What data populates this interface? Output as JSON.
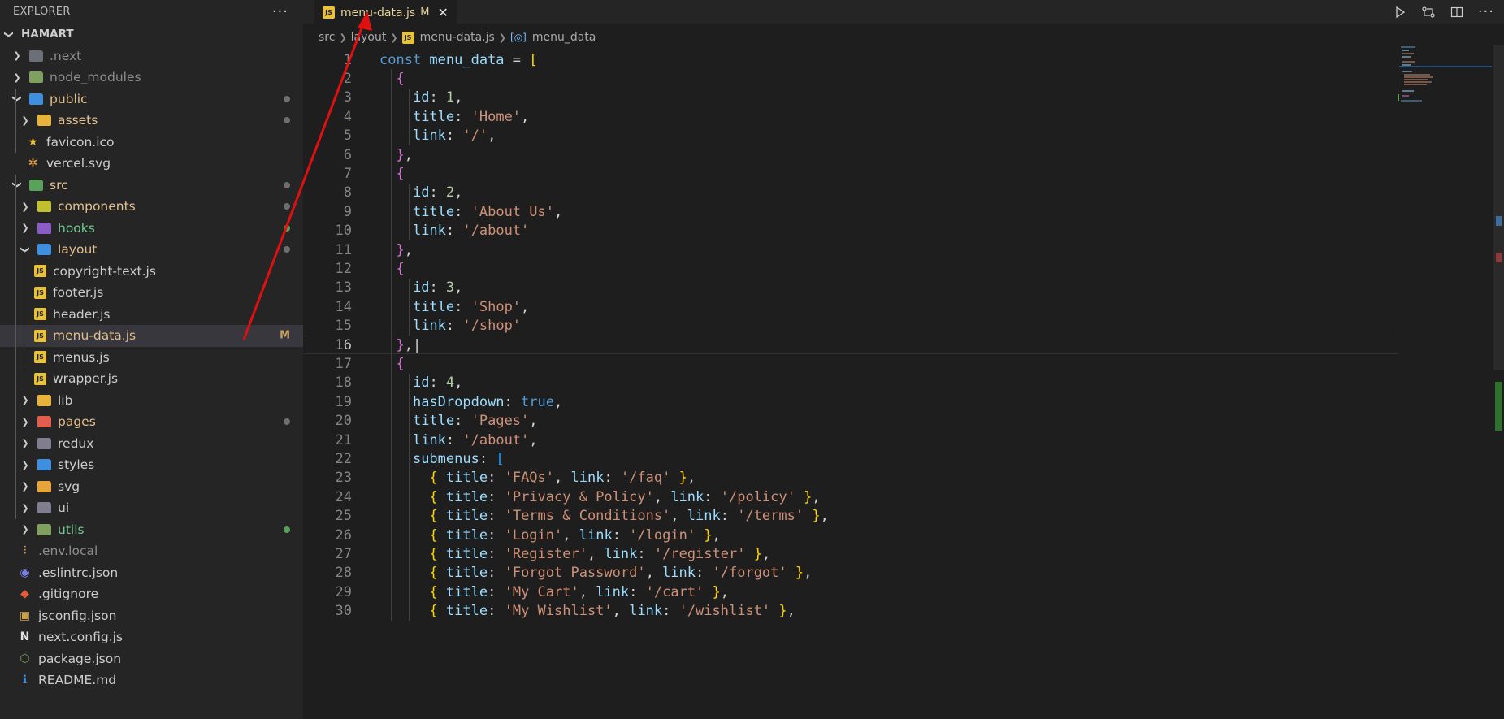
{
  "sidebar": {
    "title": "EXPLORER",
    "more": "···",
    "root": "HAMART",
    "items": [
      {
        "label": ".next",
        "depth": 1,
        "kind": "folder",
        "open": false,
        "icon": "next-folder-icon",
        "iconColor": "#6b6f77",
        "iconText": "N",
        "textColor": "#8c8c8c",
        "badge": ""
      },
      {
        "label": "node_modules",
        "depth": 1,
        "kind": "folder",
        "open": false,
        "icon": "node-folder-icon",
        "iconColor": "#7fa05e",
        "iconText": "",
        "textColor": "#8c8c8c",
        "badge": ""
      },
      {
        "label": "public",
        "depth": 1,
        "kind": "folder",
        "open": true,
        "icon": "public-folder-icon",
        "iconColor": "#3e8fe0",
        "iconText": "",
        "textColor": "#e2c08d",
        "badge": "dot"
      },
      {
        "label": "assets",
        "depth": 2,
        "kind": "folder",
        "open": false,
        "icon": "assets-folder-icon",
        "iconColor": "#e8b33a",
        "iconText": "",
        "textColor": "#e2c08d",
        "badge": "dot"
      },
      {
        "label": "favicon.ico",
        "depth": 2,
        "kind": "file",
        "icon": "star-icon",
        "glyph": "★",
        "glyphColor": "#e8c33a",
        "textColor": "#cccccc",
        "badge": ""
      },
      {
        "label": "vercel.svg",
        "depth": 2,
        "kind": "file",
        "icon": "svg-file-icon",
        "glyph": "✲",
        "glyphColor": "#f0a030",
        "textColor": "#cccccc",
        "badge": ""
      },
      {
        "label": "src",
        "depth": 1,
        "kind": "folder",
        "open": true,
        "icon": "src-folder-icon",
        "iconColor": "#5aa15a",
        "iconText": "",
        "textColor": "#e2c08d",
        "badge": "dot"
      },
      {
        "label": "components",
        "depth": 2,
        "kind": "folder",
        "open": false,
        "icon": "components-folder-icon",
        "iconColor": "#c0c030",
        "iconText": "",
        "textColor": "#e2c08d",
        "badge": "dot"
      },
      {
        "label": "hooks",
        "depth": 2,
        "kind": "folder",
        "open": false,
        "icon": "hooks-folder-icon",
        "iconColor": "#8b5cc6",
        "iconText": "",
        "textColor": "#73c991",
        "badge": "green"
      },
      {
        "label": "layout",
        "depth": 2,
        "kind": "folder",
        "open": true,
        "icon": "layout-folder-icon",
        "iconColor": "#3e8fe0",
        "iconText": "",
        "textColor": "#e2c08d",
        "badge": "dot"
      },
      {
        "label": "copyright-text.js",
        "depth": 3,
        "kind": "js",
        "textColor": "#cccccc",
        "badge": ""
      },
      {
        "label": "footer.js",
        "depth": 3,
        "kind": "js",
        "textColor": "#cccccc",
        "badge": ""
      },
      {
        "label": "header.js",
        "depth": 3,
        "kind": "js",
        "textColor": "#cccccc",
        "badge": ""
      },
      {
        "label": "menu-data.js",
        "depth": 3,
        "kind": "js",
        "textColor": "#e2c08d",
        "badge": "M",
        "active": true
      },
      {
        "label": "menus.js",
        "depth": 3,
        "kind": "js",
        "textColor": "#cccccc",
        "badge": ""
      },
      {
        "label": "wrapper.js",
        "depth": 3,
        "kind": "js",
        "textColor": "#cccccc",
        "badge": ""
      },
      {
        "label": "lib",
        "depth": 2,
        "kind": "folder",
        "open": false,
        "icon": "lib-folder-icon",
        "iconColor": "#e8b33a",
        "iconText": "",
        "textColor": "#cccccc",
        "badge": ""
      },
      {
        "label": "pages",
        "depth": 2,
        "kind": "folder",
        "open": false,
        "icon": "pages-folder-icon",
        "iconColor": "#e35d4e",
        "iconText": "",
        "textColor": "#e2c08d",
        "badge": "dot"
      },
      {
        "label": "redux",
        "depth": 2,
        "kind": "folder",
        "open": false,
        "icon": "redux-folder-icon",
        "iconColor": "#7e7e8e",
        "iconText": "",
        "textColor": "#cccccc",
        "badge": ""
      },
      {
        "label": "styles",
        "depth": 2,
        "kind": "folder",
        "open": false,
        "icon": "styles-folder-icon",
        "iconColor": "#3e8fe0",
        "iconText": "",
        "textColor": "#cccccc",
        "badge": ""
      },
      {
        "label": "svg",
        "depth": 2,
        "kind": "folder",
        "open": false,
        "icon": "svg-folder-icon",
        "iconColor": "#e8a33a",
        "iconText": "",
        "textColor": "#cccccc",
        "badge": ""
      },
      {
        "label": "ui",
        "depth": 2,
        "kind": "folder",
        "open": false,
        "icon": "ui-folder-icon",
        "iconColor": "#7e7e8e",
        "iconText": "",
        "textColor": "#cccccc",
        "badge": ""
      },
      {
        "label": "utils",
        "depth": 2,
        "kind": "folder",
        "open": false,
        "icon": "utils-folder-icon",
        "iconColor": "#7fa05e",
        "iconText": "",
        "textColor": "#73c991",
        "badge": "green"
      },
      {
        "label": ".env.local",
        "depth": 1,
        "kind": "file",
        "icon": "env-file-icon",
        "glyph": "⫶",
        "glyphColor": "#e0a050",
        "textColor": "#8c8c8c",
        "badge": ""
      },
      {
        "label": ".eslintrc.json",
        "depth": 1,
        "kind": "file",
        "icon": "eslint-file-icon",
        "glyph": "◉",
        "glyphColor": "#7b7fe8",
        "textColor": "#cccccc",
        "badge": ""
      },
      {
        "label": ".gitignore",
        "depth": 1,
        "kind": "file",
        "icon": "git-file-icon",
        "glyph": "◆",
        "glyphColor": "#e55b3a",
        "textColor": "#cccccc",
        "badge": ""
      },
      {
        "label": "jsconfig.json",
        "depth": 1,
        "kind": "file",
        "icon": "jsconfig-file-icon",
        "glyph": "▣",
        "glyphColor": "#cfa23a",
        "textColor": "#cccccc",
        "badge": ""
      },
      {
        "label": "next.config.js",
        "depth": 1,
        "kind": "file",
        "icon": "next-file-icon",
        "glyph": "N",
        "glyphColor": "#e0e0e0",
        "textColor": "#cccccc",
        "badge": ""
      },
      {
        "label": "package.json",
        "depth": 1,
        "kind": "file",
        "icon": "package-file-icon",
        "glyph": "⬡",
        "glyphColor": "#7fa05e",
        "textColor": "#cccccc",
        "badge": ""
      },
      {
        "label": "README.md",
        "depth": 1,
        "kind": "file",
        "icon": "info-icon",
        "glyph": "ℹ",
        "glyphColor": "#3e8fe0",
        "textColor": "#cccccc",
        "badge": ""
      }
    ]
  },
  "tab": {
    "label": "menu-data.js",
    "modified": "M",
    "icon_text": "JS",
    "close": "✕"
  },
  "breadcrumb": {
    "parts": [
      "src",
      "layout",
      "menu-data.js"
    ],
    "symbol": "menu_data"
  },
  "editor": {
    "current_line": 16,
    "lines": [
      [
        [
          "key",
          "const "
        ],
        [
          "var",
          "menu_data"
        ],
        [
          "pun",
          " = "
        ],
        [
          "b1",
          "["
        ]
      ],
      [
        [
          "pun",
          "  "
        ],
        [
          "b2",
          "{"
        ]
      ],
      [
        [
          "pun",
          "    "
        ],
        [
          "var",
          "id"
        ],
        [
          "pun",
          ": "
        ],
        [
          "num",
          "1"
        ],
        [
          "pun",
          ","
        ]
      ],
      [
        [
          "pun",
          "    "
        ],
        [
          "var",
          "title"
        ],
        [
          "pun",
          ": "
        ],
        [
          "str",
          "'Home'"
        ],
        [
          "pun",
          ","
        ]
      ],
      [
        [
          "pun",
          "    "
        ],
        [
          "var",
          "link"
        ],
        [
          "pun",
          ": "
        ],
        [
          "str",
          "'/'"
        ],
        [
          "pun",
          ","
        ]
      ],
      [
        [
          "pun",
          "  "
        ],
        [
          "b2",
          "}"
        ],
        [
          "pun",
          ","
        ]
      ],
      [
        [
          "pun",
          "  "
        ],
        [
          "b2",
          "{"
        ]
      ],
      [
        [
          "pun",
          "    "
        ],
        [
          "var",
          "id"
        ],
        [
          "pun",
          ": "
        ],
        [
          "num",
          "2"
        ],
        [
          "pun",
          ","
        ]
      ],
      [
        [
          "pun",
          "    "
        ],
        [
          "var",
          "title"
        ],
        [
          "pun",
          ": "
        ],
        [
          "str",
          "'About Us'"
        ],
        [
          "pun",
          ","
        ]
      ],
      [
        [
          "pun",
          "    "
        ],
        [
          "var",
          "link"
        ],
        [
          "pun",
          ": "
        ],
        [
          "str",
          "'/about'"
        ]
      ],
      [
        [
          "pun",
          "  "
        ],
        [
          "b2",
          "}"
        ],
        [
          "pun",
          ","
        ]
      ],
      [
        [
          "pun",
          "  "
        ],
        [
          "b2",
          "{"
        ]
      ],
      [
        [
          "pun",
          "    "
        ],
        [
          "var",
          "id"
        ],
        [
          "pun",
          ": "
        ],
        [
          "num",
          "3"
        ],
        [
          "pun",
          ","
        ]
      ],
      [
        [
          "pun",
          "    "
        ],
        [
          "var",
          "title"
        ],
        [
          "pun",
          ": "
        ],
        [
          "str",
          "'Shop'"
        ],
        [
          "pun",
          ","
        ]
      ],
      [
        [
          "pun",
          "    "
        ],
        [
          "var",
          "link"
        ],
        [
          "pun",
          ": "
        ],
        [
          "str",
          "'/shop'"
        ]
      ],
      [
        [
          "pun",
          "  "
        ],
        [
          "b2",
          "}"
        ],
        [
          "pun",
          ",|"
        ]
      ],
      [
        [
          "pun",
          "  "
        ],
        [
          "b2",
          "{"
        ]
      ],
      [
        [
          "pun",
          "    "
        ],
        [
          "var",
          "id"
        ],
        [
          "pun",
          ": "
        ],
        [
          "num",
          "4"
        ],
        [
          "pun",
          ","
        ]
      ],
      [
        [
          "pun",
          "    "
        ],
        [
          "var",
          "hasDropdown"
        ],
        [
          "pun",
          ": "
        ],
        [
          "bool",
          "true"
        ],
        [
          "pun",
          ","
        ]
      ],
      [
        [
          "pun",
          "    "
        ],
        [
          "var",
          "title"
        ],
        [
          "pun",
          ": "
        ],
        [
          "str",
          "'Pages'"
        ],
        [
          "pun",
          ","
        ]
      ],
      [
        [
          "pun",
          "    "
        ],
        [
          "var",
          "link"
        ],
        [
          "pun",
          ": "
        ],
        [
          "str",
          "'/about'"
        ],
        [
          "pun",
          ","
        ]
      ],
      [
        [
          "pun",
          "    "
        ],
        [
          "var",
          "submenus"
        ],
        [
          "pun",
          ": "
        ],
        [
          "b3",
          "["
        ]
      ],
      [
        [
          "pun",
          "      "
        ],
        [
          "b1",
          "{"
        ],
        [
          "pun",
          " "
        ],
        [
          "var",
          "title"
        ],
        [
          "pun",
          ": "
        ],
        [
          "str",
          "'FAQs'"
        ],
        [
          "pun",
          ", "
        ],
        [
          "var",
          "link"
        ],
        [
          "pun",
          ": "
        ],
        [
          "str",
          "'/faq'"
        ],
        [
          "pun",
          " "
        ],
        [
          "b1",
          "}"
        ],
        [
          "pun",
          ","
        ]
      ],
      [
        [
          "pun",
          "      "
        ],
        [
          "b1",
          "{"
        ],
        [
          "pun",
          " "
        ],
        [
          "var",
          "title"
        ],
        [
          "pun",
          ": "
        ],
        [
          "str",
          "'Privacy & Policy'"
        ],
        [
          "pun",
          ", "
        ],
        [
          "var",
          "link"
        ],
        [
          "pun",
          ": "
        ],
        [
          "str",
          "'/policy'"
        ],
        [
          "pun",
          " "
        ],
        [
          "b1",
          "}"
        ],
        [
          "pun",
          ","
        ]
      ],
      [
        [
          "pun",
          "      "
        ],
        [
          "b1",
          "{"
        ],
        [
          "pun",
          " "
        ],
        [
          "var",
          "title"
        ],
        [
          "pun",
          ": "
        ],
        [
          "str",
          "'Terms & Conditions'"
        ],
        [
          "pun",
          ", "
        ],
        [
          "var",
          "link"
        ],
        [
          "pun",
          ": "
        ],
        [
          "str",
          "'/terms'"
        ],
        [
          "pun",
          " "
        ],
        [
          "b1",
          "}"
        ],
        [
          "pun",
          ","
        ]
      ],
      [
        [
          "pun",
          "      "
        ],
        [
          "b1",
          "{"
        ],
        [
          "pun",
          " "
        ],
        [
          "var",
          "title"
        ],
        [
          "pun",
          ": "
        ],
        [
          "str",
          "'Login'"
        ],
        [
          "pun",
          ", "
        ],
        [
          "var",
          "link"
        ],
        [
          "pun",
          ": "
        ],
        [
          "str",
          "'/login'"
        ],
        [
          "pun",
          " "
        ],
        [
          "b1",
          "}"
        ],
        [
          "pun",
          ","
        ]
      ],
      [
        [
          "pun",
          "      "
        ],
        [
          "b1",
          "{"
        ],
        [
          "pun",
          " "
        ],
        [
          "var",
          "title"
        ],
        [
          "pun",
          ": "
        ],
        [
          "str",
          "'Register'"
        ],
        [
          "pun",
          ", "
        ],
        [
          "var",
          "link"
        ],
        [
          "pun",
          ": "
        ],
        [
          "str",
          "'/register'"
        ],
        [
          "pun",
          " "
        ],
        [
          "b1",
          "}"
        ],
        [
          "pun",
          ","
        ]
      ],
      [
        [
          "pun",
          "      "
        ],
        [
          "b1",
          "{"
        ],
        [
          "pun",
          " "
        ],
        [
          "var",
          "title"
        ],
        [
          "pun",
          ": "
        ],
        [
          "str",
          "'Forgot Password'"
        ],
        [
          "pun",
          ", "
        ],
        [
          "var",
          "link"
        ],
        [
          "pun",
          ": "
        ],
        [
          "str",
          "'/forgot'"
        ],
        [
          "pun",
          " "
        ],
        [
          "b1",
          "}"
        ],
        [
          "pun",
          ","
        ]
      ],
      [
        [
          "pun",
          "      "
        ],
        [
          "b1",
          "{"
        ],
        [
          "pun",
          " "
        ],
        [
          "var",
          "title"
        ],
        [
          "pun",
          ": "
        ],
        [
          "str",
          "'My Cart'"
        ],
        [
          "pun",
          ", "
        ],
        [
          "var",
          "link"
        ],
        [
          "pun",
          ": "
        ],
        [
          "str",
          "'/cart'"
        ],
        [
          "pun",
          " "
        ],
        [
          "b1",
          "}"
        ],
        [
          "pun",
          ","
        ]
      ],
      [
        [
          "pun",
          "      "
        ],
        [
          "b1",
          "{"
        ],
        [
          "pun",
          " "
        ],
        [
          "var",
          "title"
        ],
        [
          "pun",
          ": "
        ],
        [
          "str",
          "'My Wishlist'"
        ],
        [
          "pun",
          ", "
        ],
        [
          "var",
          "link"
        ],
        [
          "pun",
          ": "
        ],
        [
          "str",
          "'/wishlist'"
        ],
        [
          "pun",
          " "
        ],
        [
          "b1",
          "}"
        ],
        [
          "pun",
          ","
        ]
      ]
    ]
  },
  "colors": {
    "annotation_arrow": "#e01010"
  }
}
